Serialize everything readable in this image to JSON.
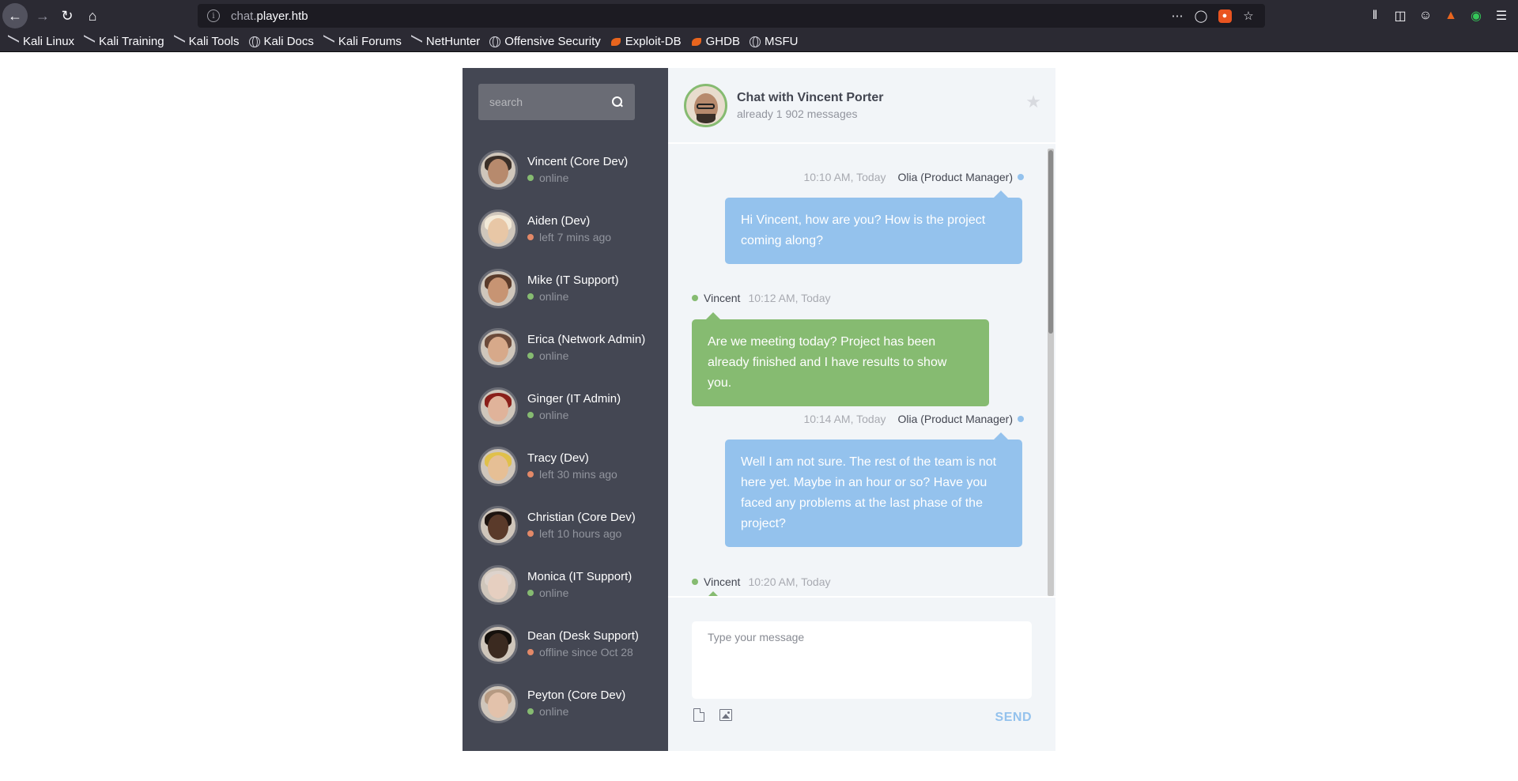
{
  "browser": {
    "url_host_dim": "chat.",
    "url_host": "player.htb",
    "bookmarks": [
      {
        "label": "Kali Linux",
        "icon": "kali"
      },
      {
        "label": "Kali Training",
        "icon": "kali"
      },
      {
        "label": "Kali Tools",
        "icon": "kali"
      },
      {
        "label": "Kali Docs",
        "icon": "globe"
      },
      {
        "label": "Kali Forums",
        "icon": "kali"
      },
      {
        "label": "NetHunter",
        "icon": "kali"
      },
      {
        "label": "Offensive Security",
        "icon": "globe"
      },
      {
        "label": "Exploit-DB",
        "icon": "exploitdb"
      },
      {
        "label": "GHDB",
        "icon": "exploitdb"
      },
      {
        "label": "MSFU",
        "icon": "globe"
      }
    ]
  },
  "sidebar": {
    "search_placeholder": "search",
    "contacts": [
      {
        "name": "Vincent (Core Dev)",
        "status": "online",
        "state": "online",
        "skin": "#b78a6d",
        "hair": "#3a2f28"
      },
      {
        "name": "Aiden (Dev)",
        "status": "left 7 mins ago",
        "state": "away",
        "skin": "#e8c7a6",
        "hair": "#f3ead8"
      },
      {
        "name": "Mike (IT Support)",
        "status": "online",
        "state": "online",
        "skin": "#c79473",
        "hair": "#5a3b2a"
      },
      {
        "name": "Erica (Network Admin)",
        "status": "online",
        "state": "online",
        "skin": "#d7a98a",
        "hair": "#6b4a3a"
      },
      {
        "name": "Ginger (IT Admin)",
        "status": "online",
        "state": "online",
        "skin": "#e0b39a",
        "hair": "#8a1f1a"
      },
      {
        "name": "Tracy (Dev)",
        "status": "left 30 mins ago",
        "state": "away",
        "skin": "#e6bf95",
        "hair": "#e0c04a"
      },
      {
        "name": "Christian (Core Dev)",
        "status": "left 10 hours ago",
        "state": "away",
        "skin": "#5a3a2a",
        "hair": "#1e1410"
      },
      {
        "name": "Monica (IT Support)",
        "status": "online",
        "state": "online",
        "skin": "#e6cfc0",
        "hair": "#ddd3cc"
      },
      {
        "name": "Dean (Desk Support)",
        "status": "offline since Oct 28",
        "state": "away",
        "skin": "#3b2a20",
        "hair": "#15100c"
      },
      {
        "name": "Peyton (Core Dev)",
        "status": "online",
        "state": "online",
        "skin": "#e3c2ab",
        "hair": "#b69a82"
      }
    ]
  },
  "chat": {
    "title": "Chat with Vincent Porter",
    "subtitle": "already 1 902 messages",
    "messages": [
      {
        "side": "other",
        "time": "10:10 AM, Today",
        "author": "Olia (Product Manager)",
        "text": "Hi Vincent, how are you? How is the project coming along?"
      },
      {
        "side": "mine",
        "time": "10:12 AM, Today",
        "author": "Vincent",
        "text": "Are we meeting today? Project has been already finished and I have results to show you."
      },
      {
        "side": "other",
        "time": "10:14 AM, Today",
        "author": "Olia (Product Manager)",
        "text": "Well I am not sure. The rest of the team is not here yet. Maybe in an hour or so? Have you faced any problems at the last phase of the project?"
      },
      {
        "side": "mine",
        "time": "10:20 AM, Today",
        "author": "Vincent",
        "text": ""
      }
    ],
    "input_placeholder": "Type your message",
    "send_label": "SEND"
  },
  "colors": {
    "online": "#86bb71",
    "away": "#e38968",
    "accent_blue": "#94c2ed"
  }
}
